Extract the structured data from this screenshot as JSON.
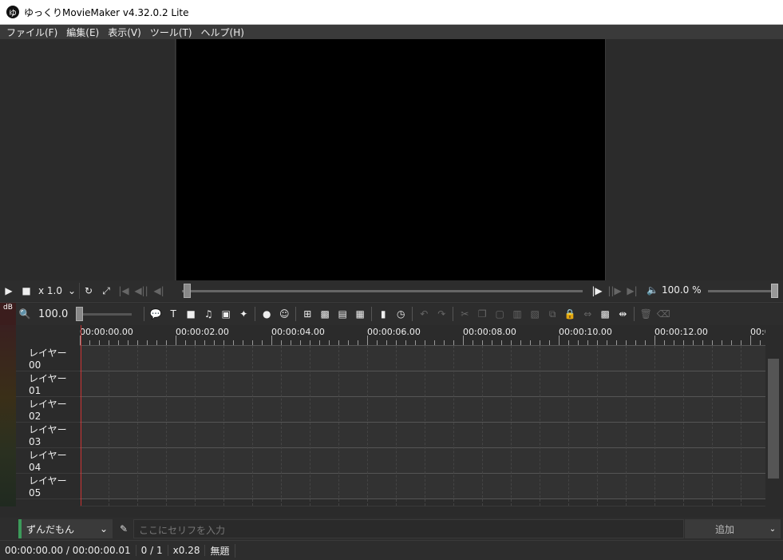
{
  "window": {
    "app_icon": "ゆ",
    "title": "ゆっくりMovieMaker v4.32.0.2 Lite"
  },
  "menu": [
    "ファイル(F)",
    "編集(E)",
    "表示(V)",
    "ツール(T)",
    "ヘルプ(H)"
  ],
  "playback": {
    "speed": "x 1.0",
    "volume": "100.0 %"
  },
  "timeline": {
    "db_label": "dB",
    "zoom": "100.0",
    "ruler_labels": [
      "00:00:00.00",
      "00:00:02.00",
      "00:00:04.00",
      "00:00:06.00",
      "00:00:08.00",
      "00:00:10.00",
      "00:00:12.00",
      "00:0"
    ],
    "layers": [
      "レイヤー 00",
      "レイヤー 01",
      "レイヤー 02",
      "レイヤー 03",
      "レイヤー 04",
      "レイヤー 05"
    ]
  },
  "input": {
    "character": "ずんだもん",
    "placeholder": "ここにセリフを入力",
    "add_label": "追加"
  },
  "status": {
    "time": "00:00:00.00",
    "sep": "/",
    "total": "00:00:00.01",
    "frame": "0",
    "frame_sep": "/",
    "frame_total": "1",
    "zoom": "x0.28",
    "project": "無題"
  }
}
